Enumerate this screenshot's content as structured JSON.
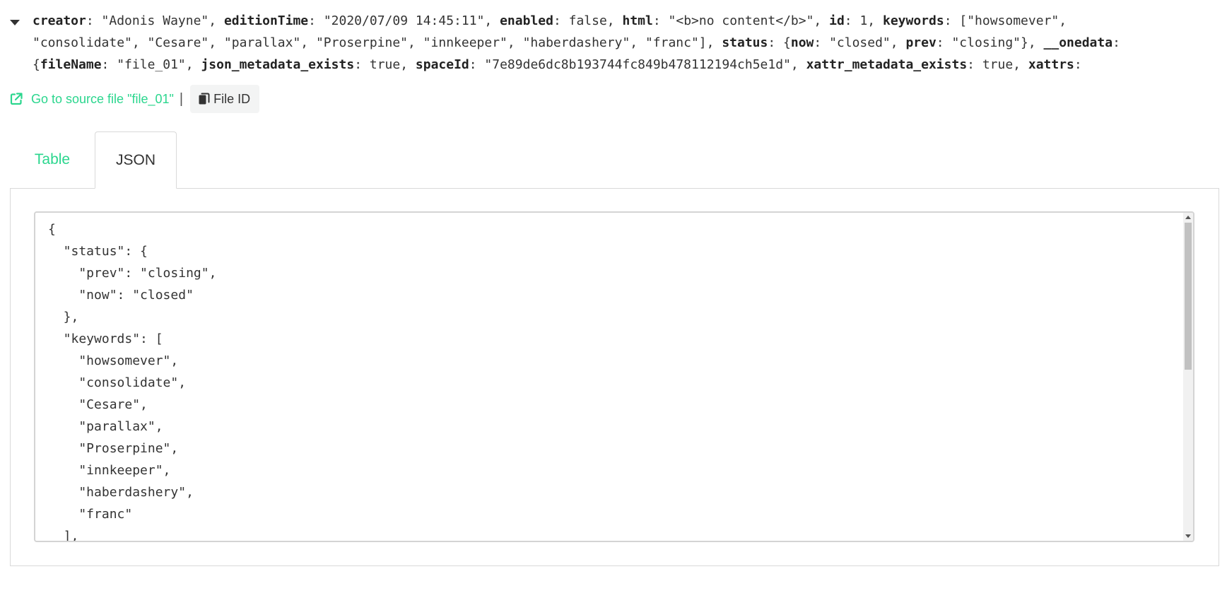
{
  "summary": {
    "line1": [
      {
        "k": "creator",
        "v": ": \"Adonis Wayne\", "
      },
      {
        "k": "editionTime",
        "v": ": \"2020/07/09 14:45:11\", "
      },
      {
        "k": "enabled",
        "v": ": false, "
      },
      {
        "k": "html",
        "v": ": \"<b>no content</b>\", "
      },
      {
        "k": "id",
        "v": ": 1, "
      },
      {
        "k": "keywords",
        "v": ": [\"howsomever\","
      }
    ],
    "line2": [
      {
        "k": "",
        "v": "\"consolidate\", \"Cesare\", \"parallax\", \"Proserpine\", \"innkeeper\", \"haberdashery\", \"franc\"], "
      },
      {
        "k": "status",
        "v": ": {"
      },
      {
        "k": "now",
        "v": ": \"closed\", "
      },
      {
        "k": "prev",
        "v": ": \"closing\"}, "
      },
      {
        "k": "__onedata",
        "v": ":"
      }
    ],
    "line3": [
      {
        "k": "",
        "v": "{"
      },
      {
        "k": "fileName",
        "v": ": \"file_01\", "
      },
      {
        "k": "json_metadata_exists",
        "v": ": true, "
      },
      {
        "k": "spaceId",
        "v": ": \"7e89de6dc8b193744fc849b478112194ch5e1d\", "
      },
      {
        "k": "xattr_metadata_exists",
        "v": ": true, "
      },
      {
        "k": "xattrs",
        "v": ":"
      }
    ]
  },
  "actions": {
    "source_link_label": "Go to source file \"file_01\"",
    "separator": "|",
    "file_id_label": "File ID"
  },
  "tabs": [
    {
      "label": "Table",
      "active": false
    },
    {
      "label": "JSON",
      "active": true
    }
  ],
  "editor": {
    "lines": [
      "{",
      "  \"status\": {",
      "    \"prev\": \"closing\",",
      "    \"now\": \"closed\"",
      "  },",
      "  \"keywords\": [",
      "    \"howsomever\",",
      "    \"consolidate\",",
      "    \"Cesare\",",
      "    \"parallax\",",
      "    \"Proserpine\",",
      "    \"innkeeper\",",
      "    \"haberdashery\",",
      "    \"franc\"",
      "  ],"
    ]
  },
  "colors": {
    "accent": "#2bd68e",
    "text": "#333333",
    "border": "#d9d9d9"
  },
  "icons": {
    "expand": "caret-down-icon",
    "source_link": "external-link-icon",
    "file_id": "copy-icon"
  }
}
